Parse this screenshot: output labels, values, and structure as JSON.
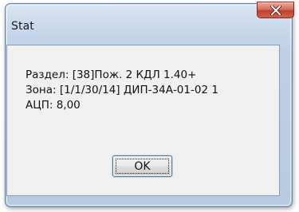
{
  "window": {
    "title": "Stat",
    "close_icon": "close-x-icon"
  },
  "message": {
    "lines": [
      "Раздел: [38]Пож. 2 КДЛ 1.40+",
      "Зона: [1/1/30/14] ДИП-34А-01-02 1",
      "АЦП: 8,00"
    ]
  },
  "buttons": {
    "ok_label": "OK"
  },
  "colors": {
    "frame": "#c7d8ec",
    "close_button": "#c0402b",
    "client_background": "#f0f0f0",
    "focus_border": "#3c7fb1"
  }
}
